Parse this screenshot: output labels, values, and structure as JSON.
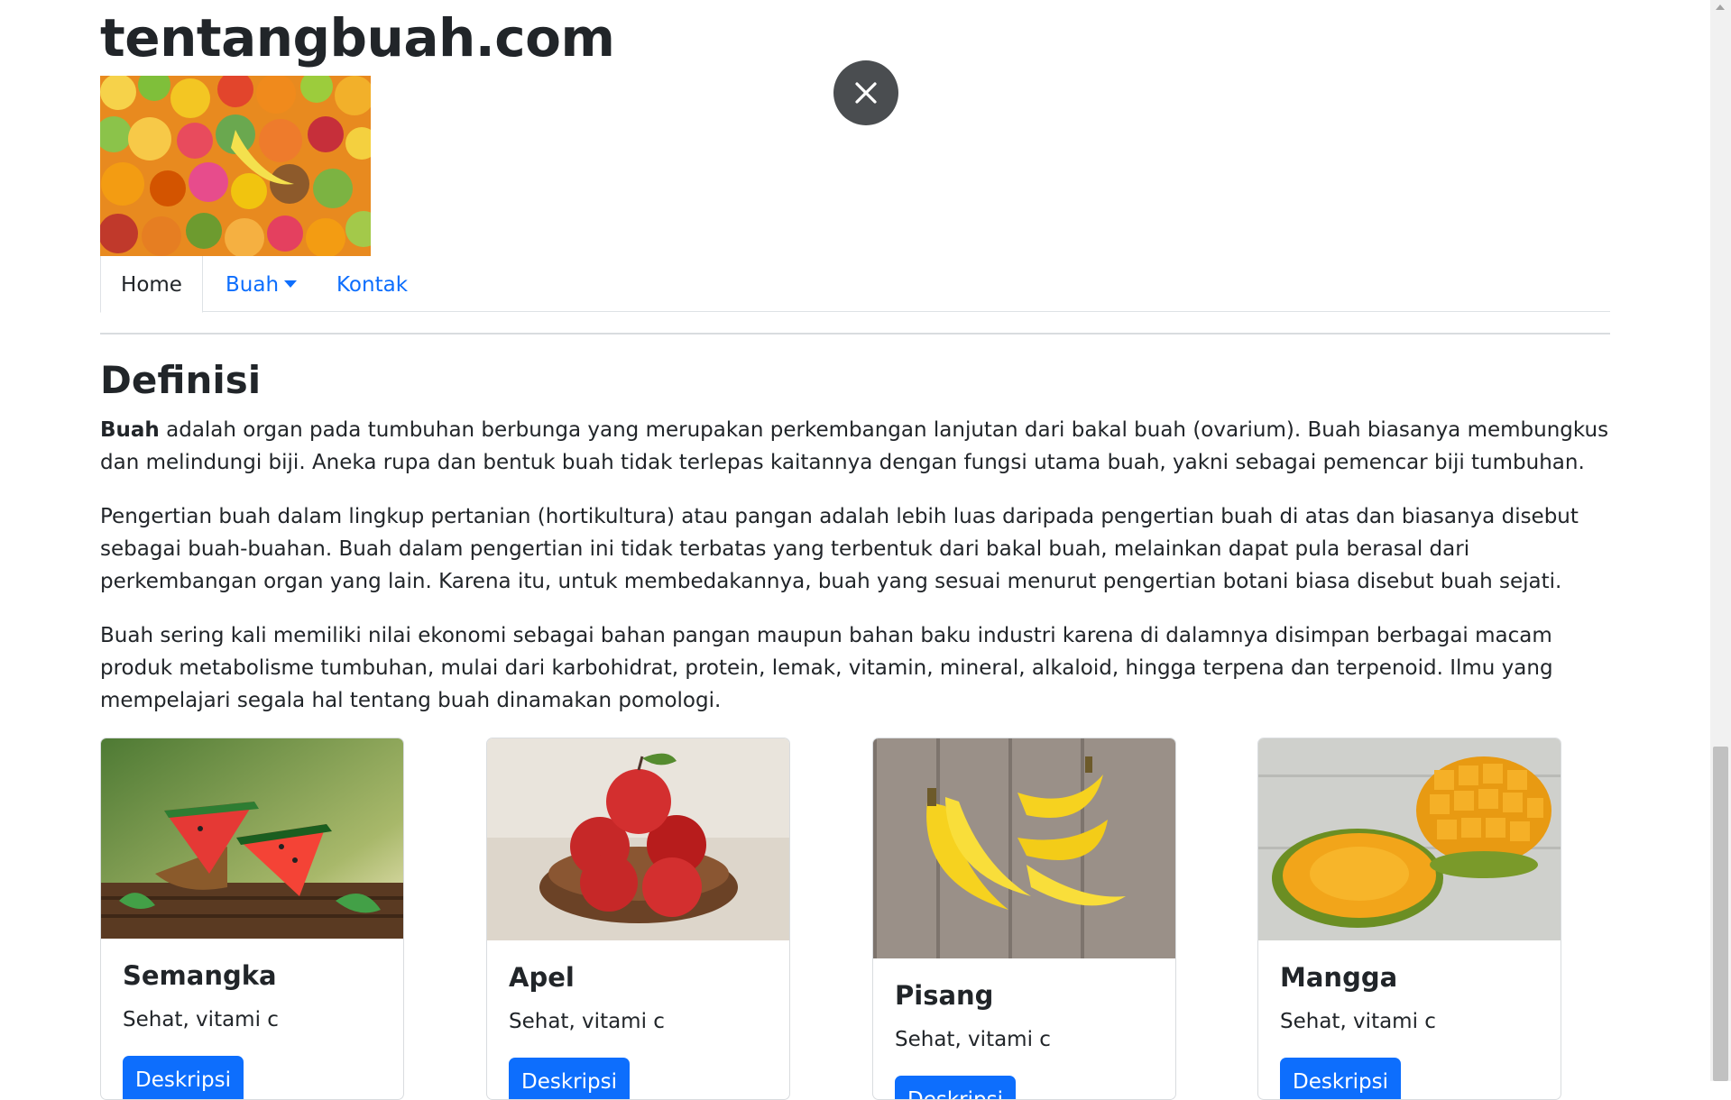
{
  "site": {
    "title": "tentangbuah.com"
  },
  "nav": {
    "items": [
      {
        "label": "Home",
        "active": true
      },
      {
        "label": "Buah",
        "dropdown": true
      },
      {
        "label": "Kontak"
      }
    ]
  },
  "main": {
    "heading": "Definisi",
    "p1_bold": "Buah",
    "p1_rest": " adalah organ pada tumbuhan berbunga yang merupakan perkembangan lanjutan dari bakal buah (ovarium). Buah biasanya membungkus dan melindungi biji. Aneka rupa dan bentuk buah tidak terlepas kaitannya dengan fungsi utama buah, yakni sebagai pemencar biji tumbuhan.",
    "p2": "Pengertian buah dalam lingkup pertanian (hortikultura) atau pangan adalah lebih luas daripada pengertian buah di atas dan biasanya disebut sebagai buah-buahan. Buah dalam pengertian ini tidak terbatas yang terbentuk dari bakal buah, melainkan dapat pula berasal dari perkembangan organ yang lain. Karena itu, untuk membedakannya, buah yang sesuai menurut pengertian botani biasa disebut buah sejati.",
    "p3": "Buah sering kali memiliki nilai ekonomi sebagai bahan pangan maupun bahan baku industri karena di dalamnya disimpan berbagai macam produk metabolisme tumbuhan, mulai dari karbohidrat, protein, lemak, vitamin, mineral, alkaloid, hingga terpena dan terpenoid. Ilmu yang mempelajari segala hal tentang buah dinamakan pomologi."
  },
  "cards": [
    {
      "title": "Semangka",
      "text": "Sehat, vitami c",
      "button": "Deskripsi"
    },
    {
      "title": "Apel",
      "text": "Sehat, vitami c",
      "button": "Deskripsi"
    },
    {
      "title": "Pisang",
      "text": "Sehat, vitami c",
      "button": "Deskripsi"
    },
    {
      "title": "Mangga",
      "text": "Sehat, vitami c",
      "button": "Deskripsi"
    }
  ],
  "colors": {
    "primary": "#0d6efd",
    "text": "#212529",
    "close_button": "#4a4d50"
  },
  "icons": {
    "close": "close-icon",
    "dropdown": "caret-down-icon"
  }
}
